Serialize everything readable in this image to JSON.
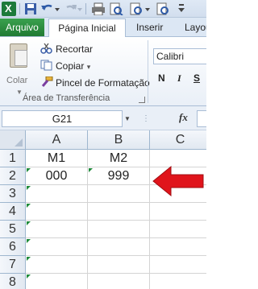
{
  "ribbon_tabs": {
    "file": "Arquivo",
    "home": "Página Inicial",
    "insert": "Inserir",
    "layout": "Layout"
  },
  "clipboard": {
    "paste_label": "Colar",
    "cut": "Recortar",
    "copy": "Copiar",
    "copy_dropdown": "▾",
    "format_painter": "Pincel de Formatação",
    "group_label": "Área de Transferência"
  },
  "font": {
    "name": "Calibri",
    "bold": "N",
    "italic": "I",
    "underline": "S",
    "underline_dropdown": "▾"
  },
  "formula_bar": {
    "name_box": "G21",
    "fx": "fx"
  },
  "sheet": {
    "columns": [
      "A",
      "B",
      "C"
    ],
    "rows": [
      "1",
      "2",
      "3",
      "4",
      "5",
      "6",
      "7",
      "8"
    ],
    "cells": {
      "A1": "M1",
      "B1": "M2",
      "A2": "000",
      "B2": "999"
    }
  },
  "colors": {
    "file_tab": "#207a33",
    "arrow": "#e0141b",
    "error_indicator": "#1e8a3a"
  }
}
